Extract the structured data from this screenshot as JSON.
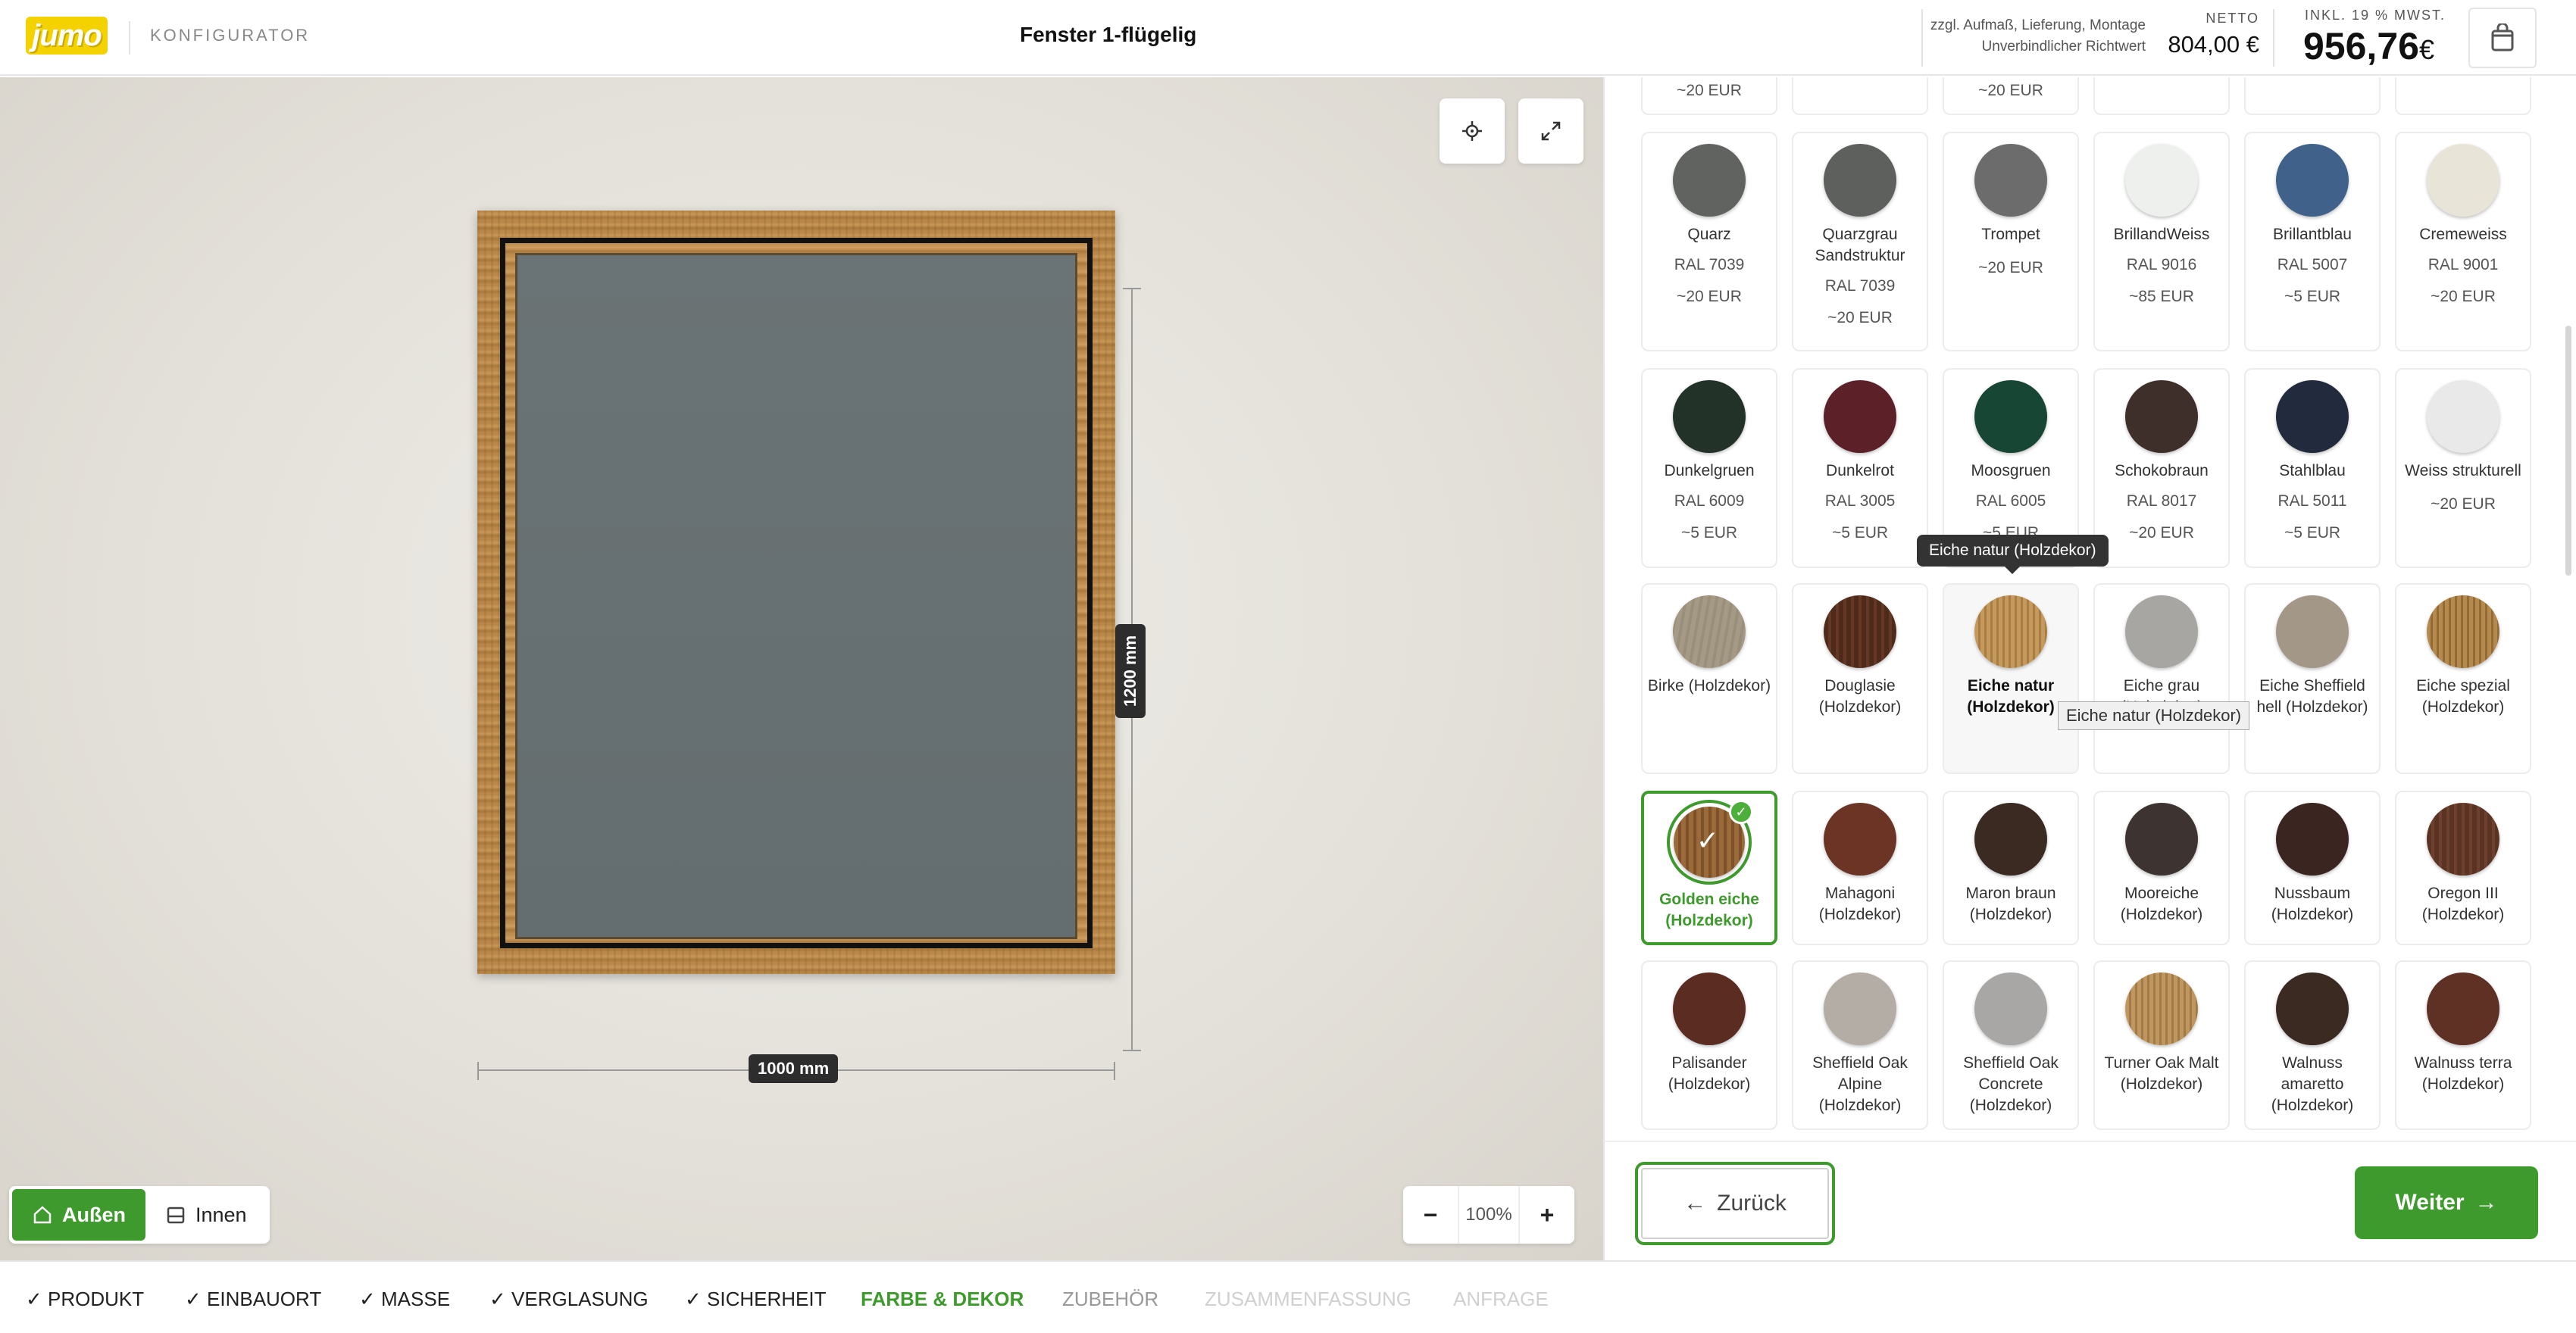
{
  "header": {
    "logo_text": "jumo",
    "section_label": "KONFIGURATOR",
    "title": "Fenster 1-flügelig",
    "note_line1": "zzgl. Aufmaß, Lieferung, Montage",
    "note_line2": "Unverbindlicher Richtwert",
    "netto_label": "NETTO",
    "netto_value": "804,00 €",
    "gross_label": "INKL. 19 % MWST.",
    "gross_value": "956,76",
    "gross_currency": "€"
  },
  "viewer": {
    "dim_height": "1200 mm",
    "dim_width": "1000 mm",
    "view_outside": "Außen",
    "view_inside": "Innen",
    "zoom_minus": "−",
    "zoom_value": "100%",
    "zoom_plus": "+"
  },
  "colors": {
    "accent": "#3e9a2c",
    "frame_wood": "#b48447",
    "glass": "#667072"
  },
  "swatches": {
    "top_partial": [
      {
        "price": "~20 EUR"
      },
      {
        "price": ""
      },
      {
        "price": "~20 EUR"
      },
      {
        "price": ""
      },
      {
        "price": ""
      },
      {
        "price": ""
      }
    ],
    "row1": [
      {
        "name": "Quarz",
        "code": "RAL 7039",
        "price": "~20 EUR",
        "color": "#616360"
      },
      {
        "name": "Quarzgrau Sandstruktur",
        "code": "RAL 7039",
        "price": "~20 EUR",
        "color": "#5e605d"
      },
      {
        "name": "Trompet",
        "code": "",
        "price": "~20 EUR",
        "color": "#6b6c6b"
      },
      {
        "name": "BrillandWeiss",
        "code": "RAL 9016",
        "price": "~85 EUR",
        "color": "#eef0ee"
      },
      {
        "name": "Brillantblau",
        "code": "RAL 5007",
        "price": "~5 EUR",
        "color": "#40618a"
      },
      {
        "name": "Cremeweiss",
        "code": "RAL 9001",
        "price": "~20 EUR",
        "color": "#e8e4d8"
      }
    ],
    "row2": [
      {
        "name": "Dunkelgruen",
        "code": "RAL 6009",
        "price": "~5 EUR",
        "color": "#233229"
      },
      {
        "name": "Dunkelrot",
        "code": "RAL 3005",
        "price": "~5 EUR",
        "color": "#5c2029"
      },
      {
        "name": "Moosgruen",
        "code": "RAL 6005",
        "price": "~5 EUR",
        "color": "#174634"
      },
      {
        "name": "Schokobraun",
        "code": "RAL 8017",
        "price": "~20 EUR",
        "color": "#3f2f2b"
      },
      {
        "name": "Stahlblau",
        "code": "RAL 5011",
        "price": "~5 EUR",
        "color": "#222a3d"
      },
      {
        "name": "Weiss strukturell",
        "code": "",
        "price": "~20 EUR",
        "color": "#e9e9e9"
      }
    ],
    "row3": [
      {
        "name": "Birke (Holzdekor)",
        "color": "#a59a85"
      },
      {
        "name": "Douglasie (Holzdekor)",
        "color": "#4e2a1b"
      },
      {
        "name": "Eiche natur (Holzdekor)",
        "color": "#c49a5c"
      },
      {
        "name": "Eiche grau (Holzdekor)",
        "color": "#a8a6a2"
      },
      {
        "name": "Eiche Sheffield hell (Holzdekor)",
        "color": "#a39887"
      },
      {
        "name": "Eiche spezial (Holzdekor)",
        "color": "#b58a4f"
      }
    ],
    "row4": [
      {
        "name": "Golden eiche (Holzdekor)",
        "color": "#9a6a3a"
      },
      {
        "name": "Mahagoni (Holzdekor)",
        "color": "#6b3424"
      },
      {
        "name": "Maron braun (Holzdekor)",
        "color": "#3a2a22"
      },
      {
        "name": "Mooreiche (Holzdekor)",
        "color": "#3d3432"
      },
      {
        "name": "Nussbaum (Holzdekor)",
        "color": "#3a2520"
      },
      {
        "name": "Oregon III (Holzdekor)",
        "color": "#5a3322"
      }
    ],
    "row5": [
      {
        "name": "Palisander (Holzdekor)",
        "color": "#5b2d22"
      },
      {
        "name": "Sheffield Oak Alpine (Holzdekor)",
        "color": "#b3ada6"
      },
      {
        "name": "Sheffield Oak Concrete (Holzdekor)",
        "color": "#a9a7a5"
      },
      {
        "name": "Turner Oak Malt (Holzdekor)",
        "color": "#c09660"
      },
      {
        "name": "Walnuss amaretto (Holzdekor)",
        "color": "#3b2a22"
      },
      {
        "name": "Walnuss terra (Holzdekor)",
        "color": "#5e3124"
      }
    ],
    "hidden_price_under_tooltip": "~5 EUR"
  },
  "tooltips": {
    "dark": "Eiche natur (Holzdekor)",
    "light": "Eiche natur (Holzdekor)"
  },
  "footer": {
    "back_label": "Zurück",
    "next_label": "Weiter"
  },
  "steps": [
    {
      "label": "✓ PRODUKT",
      "state": "done"
    },
    {
      "label": "✓ EINBAUORT",
      "state": "done"
    },
    {
      "label": "✓ MASSE",
      "state": "done"
    },
    {
      "label": "✓ VERGLASUNG",
      "state": "done"
    },
    {
      "label": "✓ SICHERHEIT",
      "state": "done"
    },
    {
      "label": "FARBE & DEKOR",
      "state": "active"
    },
    {
      "label": "ZUBEHÖR",
      "state": "next"
    },
    {
      "label": "ZUSAMMENFASSUNG",
      "state": "disabled"
    },
    {
      "label": "ANFRAGE",
      "state": "disabled"
    }
  ]
}
